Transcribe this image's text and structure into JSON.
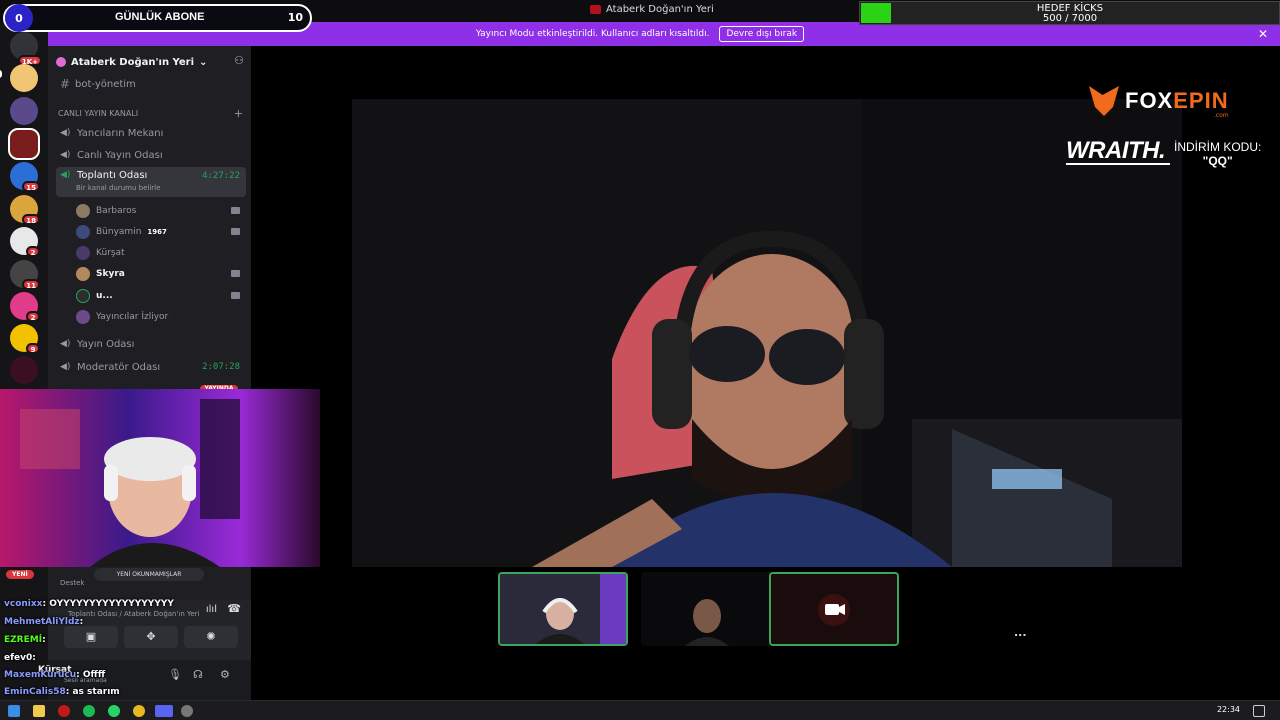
{
  "window": {
    "title": "Ataberk Doğan'ın Yeri"
  },
  "overlays": {
    "subs": {
      "count": "0",
      "label": "GÜNLÜK ABONE",
      "value": "10"
    },
    "kicks": {
      "label": "HEDEF KİCKS",
      "progress": "500 / 7000",
      "fraction": 0.0714
    }
  },
  "banner": {
    "message": "Yayıncı Modu etkinleştirildi. Kullanıcı adları kısaltıldı.",
    "button": "Devre dışı bırak",
    "close": "✕"
  },
  "rail": {
    "badges": [
      "1K+",
      "15",
      "18",
      "2",
      "11",
      "2",
      "9"
    ]
  },
  "server": {
    "name": "Ataberk Doğan'ın Yeri"
  },
  "channels": {
    "bot": "bot-yönetim",
    "category": "CANLI YAYIN KANALI",
    "c1": "Yancıların Mekanı",
    "c2": "Canlı Yayın Odası",
    "active": {
      "name": "Toplantı Odası",
      "status": "Bir kanal durumu belirle",
      "time": "4:27:22"
    },
    "users": [
      "Barbaros",
      "Bünyamin",
      "Kürşat",
      "Skyra",
      "u...",
      "Yayıncılar İzliyor"
    ],
    "bunyamin_tag": "1967",
    "c3": "Yayın Odası",
    "c4": {
      "name": "Moderatör Odası",
      "time": "2:07:28"
    },
    "live_pill": "YAYINDA"
  },
  "chat": {
    "new_label": "YENİ",
    "unread": "YENİ OKUNMAMIŞLAR",
    "lines": [
      {
        "name": "vconixx",
        "text": ": OYYYYYYYYYYYYYYYYYY"
      },
      {
        "name": "MehmetAliYldz",
        "text": ":"
      },
      {
        "name": "EZREMİ",
        "text": ":"
      },
      {
        "name": "efev0",
        "text": ":"
      },
      {
        "name": "MaxemKurucu",
        "text": ": Offff"
      },
      {
        "name": "EminCalis58",
        "text": ": as starım"
      }
    ],
    "destek": "Destek"
  },
  "voice": {
    "status": "Toplantı Odası / Ataberk Doğan'ın Yeri"
  },
  "userpanel": {
    "name": "Kürşat",
    "status": "Sesli aramada"
  },
  "sponsor": {
    "brand_a": "FOX",
    "brand_b": "EPIN",
    "domain": ".com",
    "product": "WRAITH.",
    "promo_label": "İNDİRİM KODU:",
    "promo_code": "\"QQ\""
  },
  "taskbar": {
    "time": "22:34"
  },
  "more_button": "..."
}
